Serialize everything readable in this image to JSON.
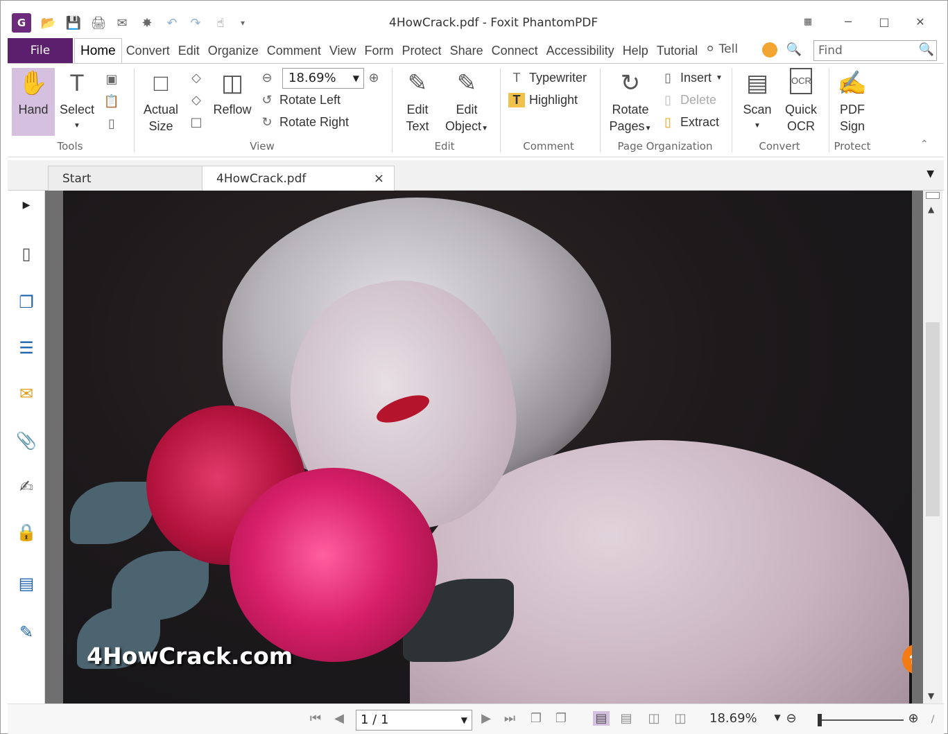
{
  "titlebar": {
    "title": "4HowCrack.pdf - Foxit PhantomPDF",
    "app_logo": "G",
    "quick_access_icons": [
      "open-folder-icon",
      "save-icon",
      "print-icon",
      "email-icon",
      "new-icon",
      "undo-icon",
      "redo-icon",
      "hand-pointer-icon"
    ],
    "window_controls": [
      "restore-grid-icon",
      "minimize-icon",
      "maximize-icon",
      "close-icon"
    ]
  },
  "menu": {
    "file": "File",
    "tabs": [
      "Home",
      "Convert",
      "Edit",
      "Organize",
      "Comment",
      "View",
      "Form",
      "Protect",
      "Share",
      "Connect",
      "Accessibility",
      "Help",
      "Tutorial"
    ],
    "tell": "Tell",
    "find_placeholder": "Find"
  },
  "ribbon": {
    "tools": {
      "hand": "Hand",
      "select": "Select",
      "group": "Tools"
    },
    "view": {
      "actual": "Actual",
      "size": "Size",
      "reflow": "Reflow",
      "zoom": "18.69%",
      "rotate_left": "Rotate Left",
      "rotate_right": "Rotate Right",
      "group": "View"
    },
    "edit": {
      "edit_text_1": "Edit",
      "edit_text_2": "Text",
      "edit_object_1": "Edit",
      "edit_object_2": "Object",
      "group": "Edit"
    },
    "comment": {
      "typewriter": "Typewriter",
      "highlight": "Highlight",
      "group": "Comment"
    },
    "page_org": {
      "rotate": "Rotate",
      "pages": "Pages",
      "insert": "Insert",
      "delete": "Delete",
      "extract": "Extract",
      "group": "Page Organization"
    },
    "convert": {
      "scan": "Scan",
      "quick": "Quick",
      "ocr": "OCR",
      "ocr_badge": "OCR",
      "group": "Convert"
    },
    "protect": {
      "pdf": "PDF",
      "sign": "Sign",
      "group": "Protect"
    }
  },
  "doc_tabs": {
    "start": "Start",
    "file": "4HowCrack.pdf",
    "close": "×"
  },
  "document": {
    "watermark": "4HowCrack.com"
  },
  "statusbar": {
    "page": "1 / 1",
    "zoom": "18.69%"
  },
  "colors": {
    "accent": "#5b1f6e",
    "hand_selected": "#d6c0e0",
    "headset": "#f47a14"
  }
}
